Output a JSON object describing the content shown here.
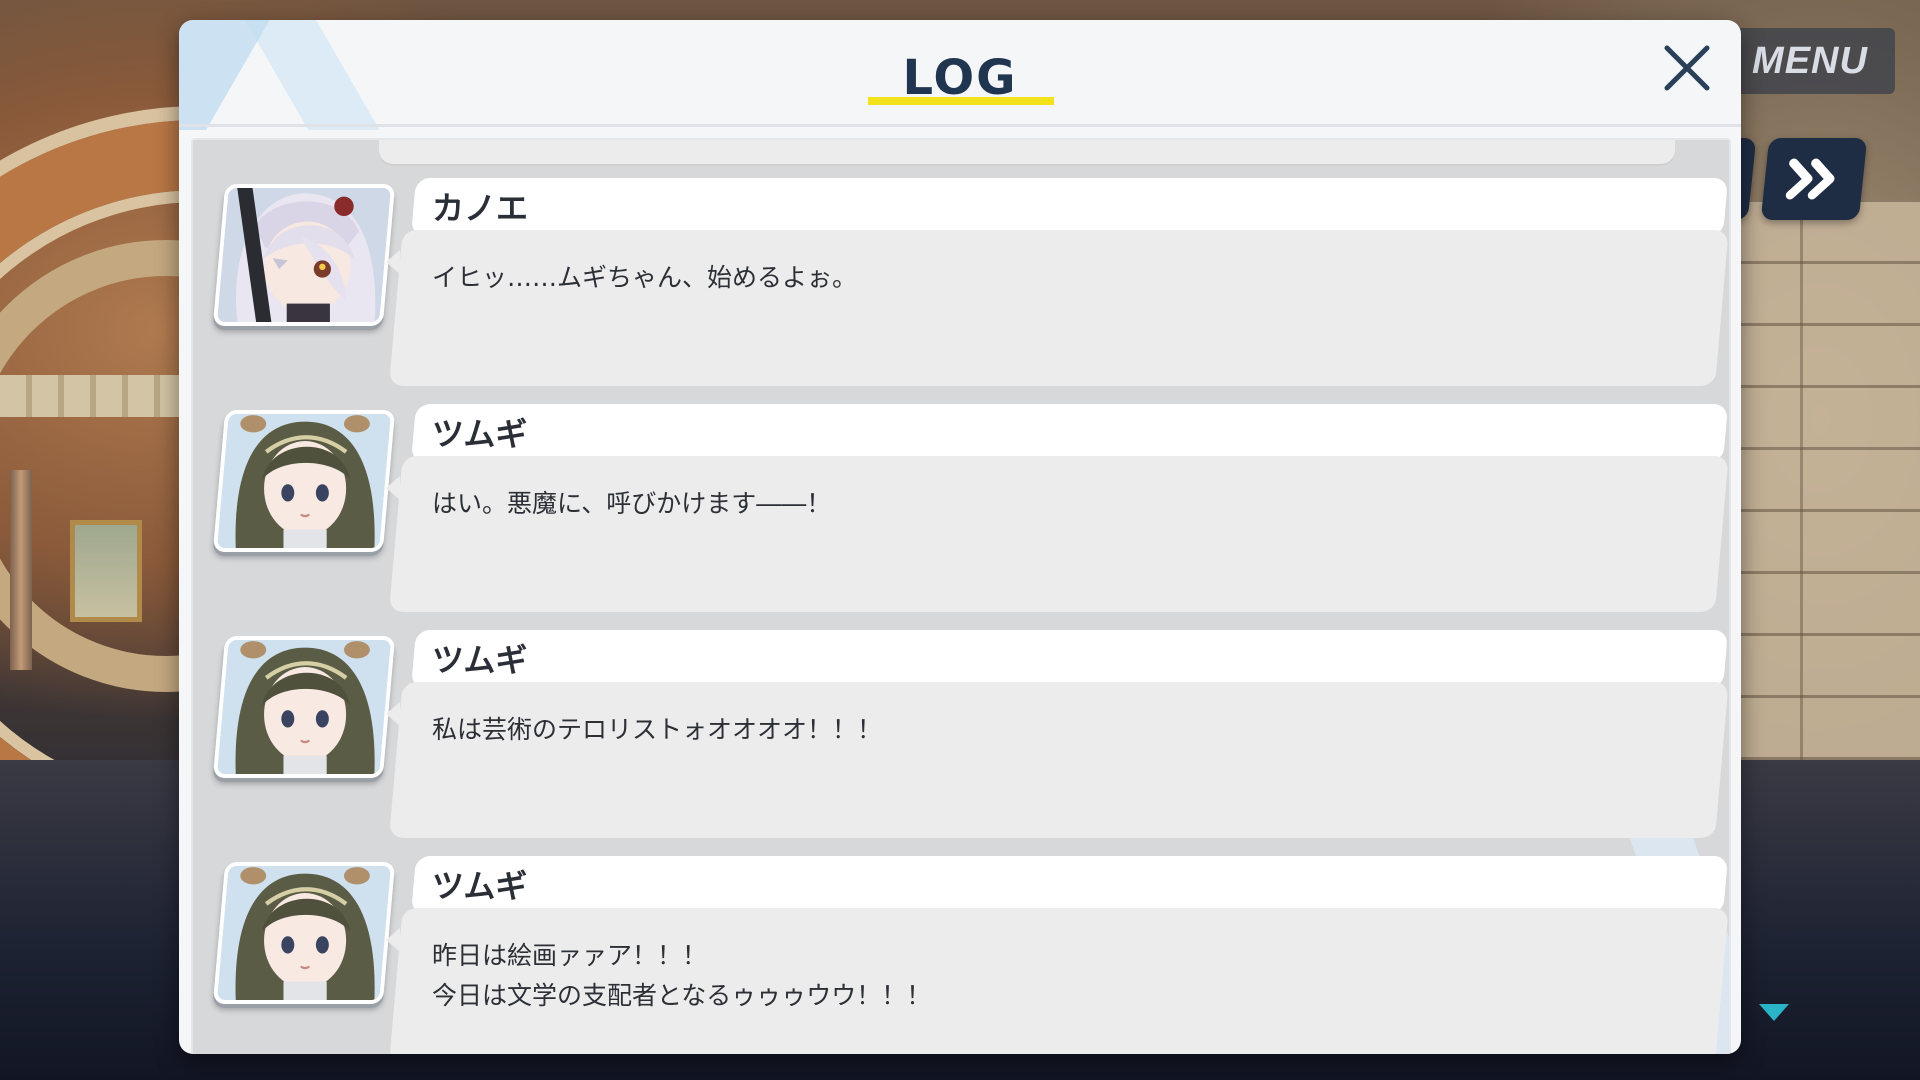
{
  "menu": {
    "label": "MENU"
  },
  "log": {
    "title": "LOG",
    "entries": [
      {
        "speaker": "カノエ",
        "avatar": "kanoe-portrait",
        "text": "イヒッ……ムギちゃん、始めるよぉ。"
      },
      {
        "speaker": "ツムギ",
        "avatar": "tsumugi-portrait",
        "text": "はい。悪魔に、呼びかけます――！"
      },
      {
        "speaker": "ツムギ",
        "avatar": "tsumugi-portrait",
        "text": "私は芸術のテロリストォオオオオ！！！"
      },
      {
        "speaker": "ツムギ",
        "avatar": "tsumugi-portrait",
        "text": "昨日は絵画ァァア！！！\n今日は文学の支配者となるゥゥゥウウ！！！"
      }
    ]
  },
  "colors": {
    "title": "#1f3550",
    "underline": "#f3e21b",
    "skip_button": "#1e2c44",
    "scroll_indicator": "#2bb3c8"
  },
  "icons": {
    "close": "close-icon",
    "skip": "fast-forward-icon",
    "scroll": "chevron-down-icon"
  }
}
